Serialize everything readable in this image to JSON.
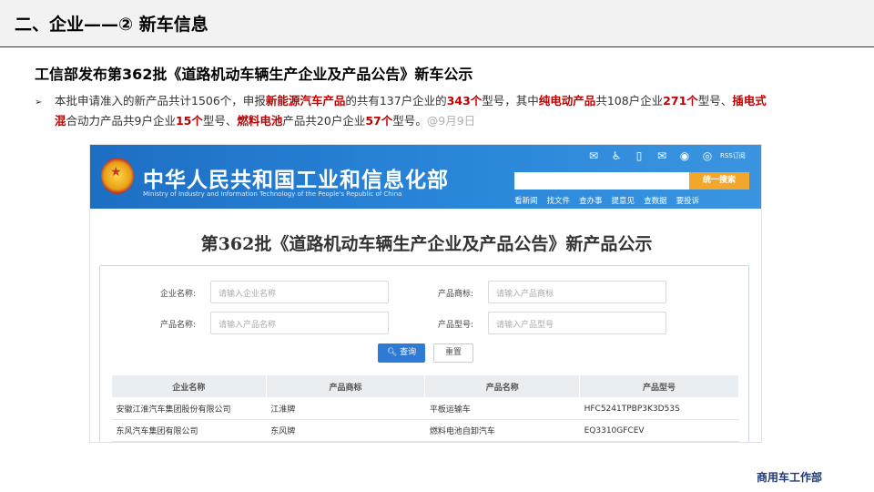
{
  "header": {
    "title": "二、企业——② 新车信息"
  },
  "subtitle": "工信部发布第362批《道路机动车辆生产企业及产品公告》新车公示",
  "bullet": {
    "arrow": "➢",
    "p1": "本批申请准入的新产品共计1506个，申报",
    "r1": "新能源汽车产品",
    "p2": "的共有137户企业的",
    "r2": "343个",
    "p3": "型号，其中",
    "r3": "纯电动产品",
    "p4": "共108户企业",
    "r4": "271个",
    "p5": "型号、",
    "r5": "插电式",
    "r5b": "混",
    "p6": "合动力产品共9户企业",
    "r6": "15个",
    "p7": "型号、",
    "r7": "燃料电池",
    "p8": "产品共20户企业",
    "r8": "57个",
    "p9": "型号。",
    "date": "@9月9日"
  },
  "screenshot": {
    "site_name": "中华人民共和国工业和信息化部",
    "site_name_en": "Ministry of Industry and Information Technology of the People's Republic of China",
    "icons": [
      "wechat-icon",
      "accessibility-icon",
      "mobile-icon",
      "mail-icon",
      "weibo-icon",
      "rss-icon"
    ],
    "rss_label": "RSS订阅",
    "search_button": "统一搜索",
    "nav": [
      "看新闻",
      "找文件",
      "查办事",
      "提意见",
      "查数据",
      "要投诉"
    ],
    "heading": "第362批《道路机动车辆生产企业及产品公告》新产品公示",
    "form": {
      "company_label": "企业名称:",
      "company_placeholder": "请输入企业名称",
      "brand_label": "产品商标:",
      "brand_placeholder": "请输入产品商标",
      "product_label": "产品名称:",
      "product_placeholder": "请输入产品名称",
      "model_label": "产品型号:",
      "model_placeholder": "请输入产品型号",
      "query_button": "查询",
      "reset_button": "重置"
    },
    "table": {
      "headers": [
        "企业名称",
        "产品商标",
        "产品名称",
        "产品型号"
      ],
      "rows": [
        [
          "安徽江淮汽车集团股份有限公司",
          "江淮牌",
          "平板运输车",
          "HFC5241TPBP3K3D53S"
        ],
        [
          "东风汽车集团有限公司",
          "东风牌",
          "燃料电池自卸汽车",
          "EQ3310GFCEV"
        ]
      ]
    }
  },
  "footer": "商用车工作部",
  "colors": {
    "accent_red": "#c00000",
    "brand_blue": "#1f3a7a",
    "banner_blue": "#1d6fc4",
    "search_orange": "#f2a72c"
  }
}
